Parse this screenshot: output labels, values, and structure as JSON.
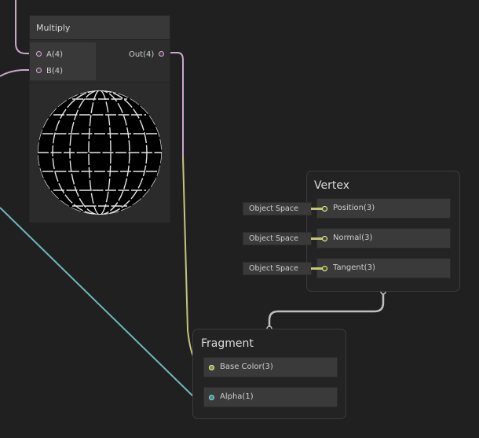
{
  "multiply_node": {
    "title": "Multiply",
    "inputs": [
      {
        "label": "A(4)"
      },
      {
        "label": "B(4)"
      }
    ],
    "output": {
      "label": "Out(4)"
    }
  },
  "vertex_block": {
    "title": "Vertex",
    "slots": [
      {
        "label": "Position(3)",
        "space": "Object Space"
      },
      {
        "label": "Normal(3)",
        "space": "Object Space"
      },
      {
        "label": "Tangent(3)",
        "space": "Object Space"
      }
    ]
  },
  "fragment_block": {
    "title": "Fragment",
    "slots": [
      {
        "label": "Base Color(3)"
      },
      {
        "label": "Alpha(1)"
      }
    ]
  },
  "colors": {
    "background": "#202020",
    "vector4_port": "#d4a9d4",
    "vector3_port": "#f6ff9a",
    "float_port": "#84e4e7",
    "wire_vector4": "#c9a8c9",
    "wire_vector3": "#c4c67c",
    "wire_float": "#6fb8b9",
    "wire_flow": "#bfbfbf"
  }
}
